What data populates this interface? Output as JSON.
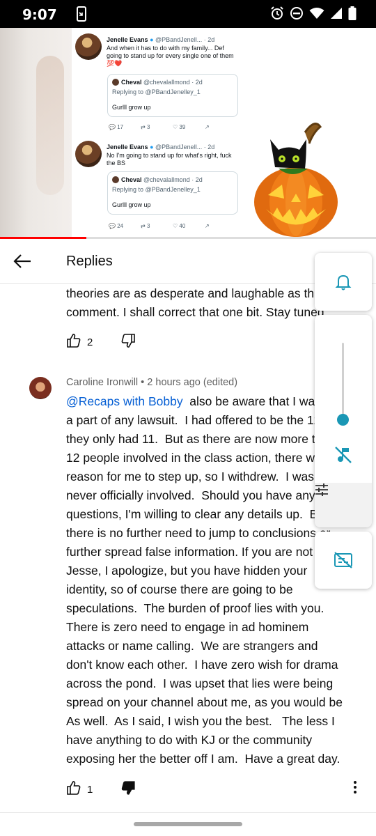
{
  "status_bar": {
    "time": "9:07",
    "icons": [
      "phone-mirror-icon",
      "alarm-icon",
      "do-not-disturb-icon",
      "wifi-icon",
      "signal-icon",
      "battery-icon"
    ]
  },
  "video": {
    "progress_fraction": 0.23,
    "tweets": [
      {
        "name": "Jenelle Evans",
        "handle": "@PBandJenell... · 2d",
        "body": "And when it has to do with my family... Def going to stand up for every single one of them 💯❤️",
        "quote_name": "Cheval",
        "quote_handle": "@chevalallmond · 2d",
        "quote_reply": "Replying to @PBandJenelley_1",
        "quote_text": "Gurlll grow up",
        "replies": "17",
        "retweets": "3",
        "likes": "39"
      },
      {
        "name": "Jenelle Evans",
        "handle": "@PBandJenell... · 2d",
        "body": "No I'm going to stand up for what's right, fuck the BS",
        "quote_name": "Cheval",
        "quote_handle": "@chevalallmond · 2d",
        "quote_reply": "Replying to @PBandJenelley_1",
        "quote_text": "Gurlll grow up",
        "replies": "24",
        "retweets": "3",
        "likes": "40"
      }
    ]
  },
  "header": {
    "title": "Replies"
  },
  "comments": [
    {
      "text": "theories are as desperate and laughable as this\ncomment. I shall correct that one bit. Stay tuned.",
      "likes": "2"
    },
    {
      "author": "Caroline Ironwill",
      "meta": "Caroline Ironwill • 2 hours ago (edited)",
      "mention": "@Recaps with Bobby",
      "text": "  also be aware that I was never\na part of any lawsuit.  I had offered to be the 12th as\nthey only had 11.  But as there are now more than\n12 people involved in the class action, there was no\nreason for me to step up, so I withdrew.  I was\nnever officially involved.  Should you have any\nquestions, I'm willing to clear any details up.  But\nthere is no further need to jump to conclusions or\nfurther spread false information. If you are not\nJesse, I apologize, but you have hidden your\nidentity, so of course there are going to be\nspeculations.  The burden of proof lies with you.\nThere is zero need to engage in ad hominem\nattacks or name calling.  We are strangers and\ndon't know each other.  I have zero wish for drama\nacross the pond.  I was upset that lies were being\nspread on your channel about me, as you would be\nAs well.  As I said, I wish you the best.   The less I\nhave anything to do with KJ or the community\nexposing her the better off I am.  Have a great day.",
      "likes": "1"
    }
  ],
  "side_panel": {
    "volume_level": 0.2,
    "accent_color": "#1a97b5"
  }
}
